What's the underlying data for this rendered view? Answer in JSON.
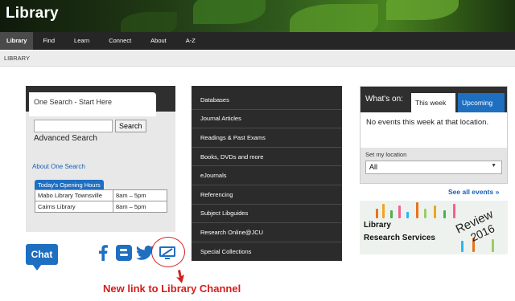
{
  "header": {
    "title": "Library"
  },
  "nav": {
    "items": [
      "Library",
      "Find",
      "Learn",
      "Connect",
      "About",
      "A-Z"
    ]
  },
  "breadcrumb": "LIBRARY",
  "search": {
    "tab_label": "One Search - Start Here",
    "input_value": "",
    "button_label": "Search",
    "advanced_label": "Advanced Search",
    "about_label": "About One Search"
  },
  "hours": {
    "tab_label": "Today's Opening Hours",
    "rows": [
      {
        "place": "Mabo Library Townsville",
        "time": "8am – 5pm"
      },
      {
        "place": "Cairns Library",
        "time": "8am – 5pm"
      }
    ]
  },
  "social": {
    "chat_label": "Chat"
  },
  "annotation": "New link to Library Channel",
  "links": [
    "Databases",
    "Journal Articles",
    "Readings & Past Exams",
    "Books, DVDs and more",
    "eJournals",
    "Referencing",
    "Subject Libguides",
    "Research Online@JCU",
    "Special Collections"
  ],
  "whats_on": {
    "label": "What's on:",
    "tab_this_week": "This week",
    "tab_upcoming": "Upcoming",
    "message": "No events this week at that location.",
    "location_label": "Set my location",
    "location_value": "All",
    "see_all": "See all events »"
  },
  "review": {
    "line1": "Library",
    "line2": "Research Services",
    "word": "Review",
    "year": "2016"
  },
  "colors": {
    "accent_blue": "#1f6fc1",
    "annotation_red": "#d71c1c",
    "dark_panel": "#2b2b2b"
  }
}
